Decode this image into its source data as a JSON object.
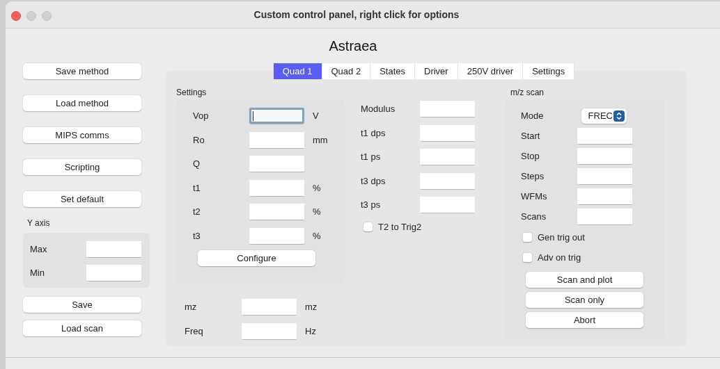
{
  "window": {
    "title": "Custom control panel, right click for options"
  },
  "heading": "Astraea",
  "sidebar": {
    "buttons": [
      {
        "label": "Save method"
      },
      {
        "label": "Load method"
      },
      {
        "label": "MIPS comms"
      },
      {
        "label": "Scripting"
      },
      {
        "label": "Set default"
      }
    ],
    "y_axis": {
      "title": "Y axis",
      "fields": [
        {
          "label": "Max"
        },
        {
          "label": "Min"
        }
      ]
    },
    "bottom_buttons": [
      {
        "label": "Save"
      },
      {
        "label": "Load scan"
      }
    ]
  },
  "tabs": [
    {
      "label": "Quad 1",
      "selected": true
    },
    {
      "label": "Quad 2",
      "selected": false
    },
    {
      "label": "States",
      "selected": false
    },
    {
      "label": "Driver",
      "selected": false
    },
    {
      "label": "250V driver",
      "selected": false
    },
    {
      "label": "Settings",
      "selected": false
    }
  ],
  "settings": {
    "title": "Settings",
    "fields": [
      {
        "label": "Vop",
        "unit": "V",
        "focused": true
      },
      {
        "label": "Ro",
        "unit": "mm",
        "focused": false
      },
      {
        "label": "Q",
        "focused": false
      },
      {
        "label": "t1",
        "unit": "%",
        "focused": false
      },
      {
        "label": "t2",
        "unit": "%",
        "focused": false
      },
      {
        "label": "t3",
        "unit": "%",
        "focused": false
      }
    ],
    "button": "Configure"
  },
  "timing": {
    "fields": [
      {
        "label": "Modulus"
      },
      {
        "label": "t1 dps"
      },
      {
        "label": "t1 ps"
      },
      {
        "label": "t3 dps"
      },
      {
        "label": "t3 ps"
      }
    ],
    "checkbox": {
      "label": "T2 to Trig2",
      "checked": false
    }
  },
  "outputs": [
    {
      "label": "mz",
      "unit": "mz"
    },
    {
      "label": "Freq",
      "unit": "Hz"
    }
  ],
  "mz_scan": {
    "title": "m/z scan",
    "mode": {
      "label": "Mode",
      "value": "FREC"
    },
    "fields": [
      {
        "label": "Start"
      },
      {
        "label": "Stop"
      },
      {
        "label": "Steps"
      },
      {
        "label": "WFMs"
      },
      {
        "label": "Scans"
      }
    ],
    "checkboxes": [
      {
        "label": "Gen trig out",
        "checked": false
      },
      {
        "label": "Adv on trig",
        "checked": false
      }
    ],
    "buttons": [
      "Scan and plot",
      "Scan only",
      "Abort"
    ]
  }
}
